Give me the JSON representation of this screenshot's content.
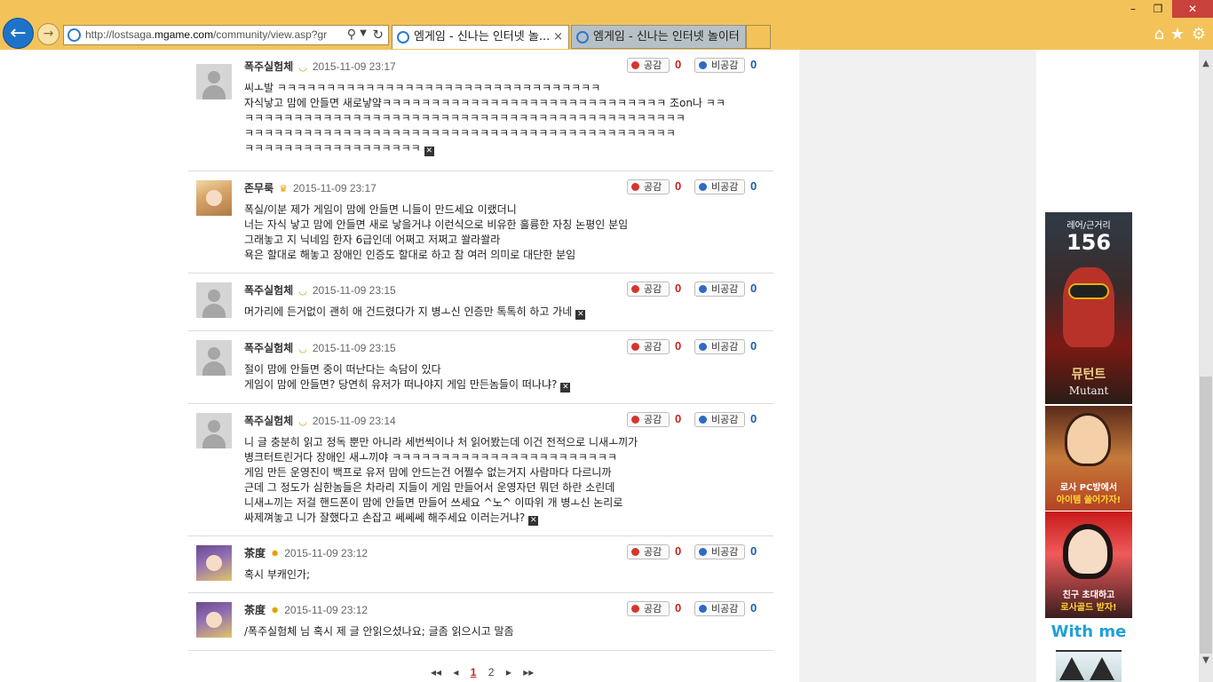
{
  "browser": {
    "address": {
      "prefix": "http://lostsaga.",
      "domain": "mgame.com",
      "path": "/community/view.asp?gr"
    },
    "tabs": [
      {
        "label": "엠게임 - 신나는 인터넷 놀..."
      },
      {
        "label": "엠게임 - 신나는 인터넷 놀이터"
      }
    ],
    "window_controls": {
      "minimize": "–",
      "maximize": "❐",
      "close": "✕"
    }
  },
  "vote_labels": {
    "up": "공감",
    "down": "비공감"
  },
  "comments": [
    {
      "nick": "폭주실험체",
      "date": "2015-11-09 23:17",
      "up": "0",
      "down": "0",
      "body": "씨ㅗ발 ㅋㅋㅋㅋㅋㅋㅋㅋㅋㅋㅋㅋㅋㅋㅋㅋㅋㅋㅋㅋㅋㅋㅋㅋㅋㅋㅋㅋㅋㅋㅋㅋㅋ\n자식낳고 맘에 안들면 새로낳얔ㅋㅋㅋㅋㅋㅋㅋㅋㅋㅋㅋㅋㅋㅋㅋㅋㅋㅋㅋㅋㅋㅋㅋㅋㅋㅋㅋㅋㅋ 조on나 ㅋㅋ\nㅋㅋㅋㅋㅋㅋㅋㅋㅋㅋㅋㅋㅋㅋㅋㅋㅋㅋㅋㅋㅋㅋㅋㅋㅋㅋㅋㅋㅋㅋㅋㅋㅋㅋㅋㅋㅋㅋㅋㅋㅋㅋㅋㅋㅋ\nㅋㅋㅋㅋㅋㅋㅋㅋㅋㅋㅋㅋㅋㅋㅋㅋㅋㅋㅋㅋㅋㅋㅋㅋㅋㅋㅋㅋㅋㅋㅋㅋㅋㅋㅋㅋㅋㅋㅋㅋㅋㅋㅋㅋ\nㅋㅋㅋㅋㅋㅋㅋㅋㅋㅋㅋㅋㅋㅋㅋㅋㅋㅋ"
    },
    {
      "nick": "존무룩",
      "date": "2015-11-09 23:17",
      "up": "0",
      "down": "0",
      "body": "폭실/이분 제가 게임이 맘에 안들면 니들이 만드세요 이랬더니\n너는 자식 낳고 맘에 안들면 새로 낳을거냐 이런식으로 비유한 훌륭한 자칭 논평인 분임\n그래놓고 지 닉네임 한자 6급인데 어쩌고 저쩌고 쏼라쏼라\n욕은 할대로 해놓고 장애인 인증도 할대로 하고 참 여러 의미로 대단한 분임"
    },
    {
      "nick": "폭주실험체",
      "date": "2015-11-09 23:15",
      "up": "0",
      "down": "0",
      "body": "머가리에 든거없이 괜히 애 건드렸다가 지 병ㅗ신 인증만 톡톡히 하고 가네"
    },
    {
      "nick": "폭주실험체",
      "date": "2015-11-09 23:15",
      "up": "0",
      "down": "0",
      "body": "절이 맘에 안들면 중이 떠난다는 속담이 있다\n게임이 맘에 안들면? 당연히 유저가 떠나야지 게임 만든놈들이 떠나냐?"
    },
    {
      "nick": "폭주실험체",
      "date": "2015-11-09 23:14",
      "up": "0",
      "down": "0",
      "body": "니 글 충분히 읽고 정독 뿐만 아니라 세번씩이나 처 읽어봤는데 이건 전적으로 니새ㅗ끼가\n병크터트린거다 장애인 새ㅗ끼야 ㅋㅋㅋㅋㅋㅋㅋㅋㅋㅋㅋㅋㅋㅋㅋㅋㅋㅋㅋㅋㅋㅋㅋ\n게임 만든 운영진이 백프로 유저 맘에 안드는건 어쩔수 없는거지 사람마다 다르니까\n근데 그 정도가 심한놈들은 차라리 지들이 게임 만들어서 운영자던 뭐던 하란 소린데\n니새ㅗ끼는 저걸 핸드폰이 맘에 안들면 만들어 쓰세요 ^노^ 이따위 개 병ㅗ신 논리로\n싸제껴놓고 니가 잘했다고 손잡고 쎄쎄쎄 해주세요 이러는거냐?"
    },
    {
      "nick": "茶度",
      "date": "2015-11-09 23:12",
      "up": "0",
      "down": "0",
      "body": "혹시 부캐인가;"
    },
    {
      "nick": "茶度",
      "date": "2015-11-09 23:12",
      "up": "0",
      "down": "0",
      "body": "/폭주실험체 님 혹시 제 글 안읽으셨나요; 글좀 읽으시고 말좀"
    }
  ],
  "pager": {
    "first": "◂◂",
    "prev": "◂",
    "current": "1",
    "next_page": "2",
    "next": "▸",
    "last": "▸▸"
  },
  "ad": {
    "top_text": "레어/근거리",
    "number": "156",
    "name": "뮤턴트",
    "name_en": "Mutant",
    "pc_line1": "로사 PC방에서",
    "pc_line2": "아이템 쓸어가자!",
    "invite_line1": "친구 초대하고",
    "invite_line2": "로사골드 받자!",
    "withme": "With me"
  }
}
